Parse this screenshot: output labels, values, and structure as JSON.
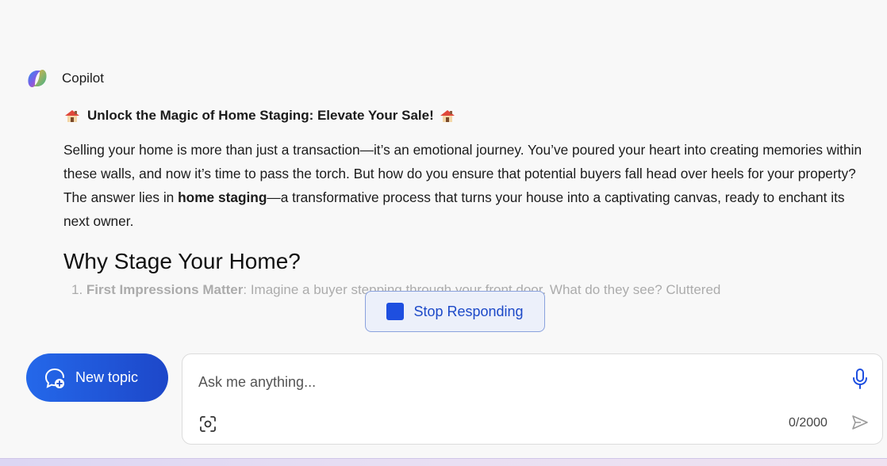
{
  "sender": {
    "name": "Copilot"
  },
  "message": {
    "headline": "Unlock the Magic of Home Staging: Elevate Your Sale!",
    "paragraph_part1": "Selling your home is more than just a transaction—it’s an emotional journey. You’ve poured your heart into creating memories within these walls, and now it’s time to pass the torch. But how do you ensure that potential buyers fall head over heels for your property? The answer lies in ",
    "paragraph_bold": "home staging",
    "paragraph_part2": "—a transformative process that turns your house into a captivating canvas, ready to enchant its next owner.",
    "section_heading": "Why Stage Your Home?",
    "list_item_number": "1.",
    "list_item_bold": "First Impressions Matter",
    "list_item_text": ": Imagine a buyer stepping through your front door. What do they see? Cluttered"
  },
  "stop_button": {
    "label": "Stop Responding"
  },
  "new_topic": {
    "label": "New topic"
  },
  "composer": {
    "placeholder": "Ask me anything...",
    "char_count": "0/2000"
  },
  "icons": {
    "logo": "copilot-logo",
    "house": "house-emoji-icon",
    "mic": "microphone-icon",
    "screenshot": "visual-search-icon",
    "send": "send-icon",
    "new_topic": "new-chat-bubble-icon"
  },
  "colors": {
    "accent": "#1e4fe0",
    "background": "#f8f8f8"
  }
}
